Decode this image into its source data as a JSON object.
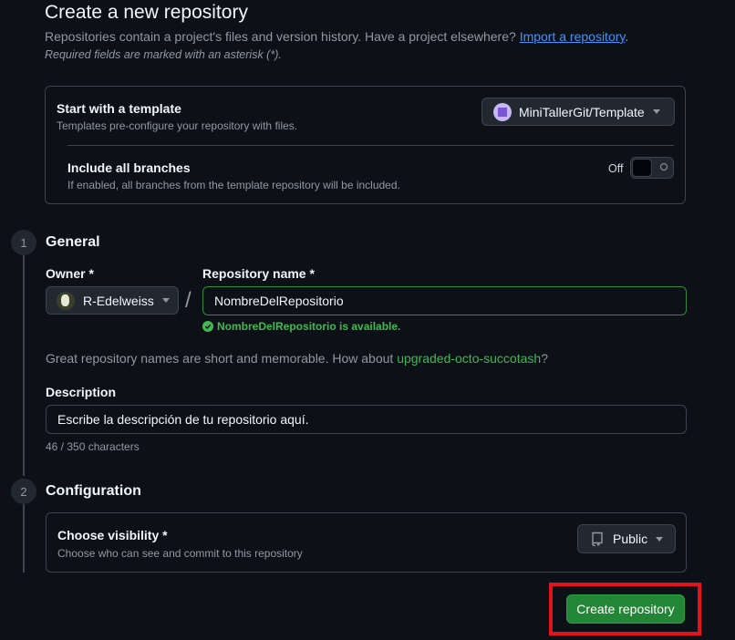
{
  "header": {
    "title": "Create a new repository",
    "subtitle": "Repositories contain a project's files and version history. Have a project elsewhere?",
    "import_link": "Import a repository",
    "subtitle_end": ".",
    "required_note": "Required fields are marked with an asterisk (*)."
  },
  "template": {
    "title": "Start with a template",
    "description": "Templates pre-configure your repository with files.",
    "selected": "MiniTallerGit/Template",
    "include_branches": {
      "title": "Include all branches",
      "description": "If enabled, all branches from the template repository will be included.",
      "state_label": "Off"
    }
  },
  "general": {
    "step": "1",
    "title": "General",
    "owner_label": "Owner *",
    "owner_value": "R-Edelweiss",
    "separator": "/",
    "name_label": "Repository name *",
    "name_value": "NombreDelRepositorio",
    "availability": "NombreDelRepositorio is available.",
    "hint_prefix": "Great repository names are short and memorable. How about",
    "hint_suggestion": "upgraded-octo-succotash",
    "hint_suffix": "?",
    "description_label": "Description",
    "description_value": "Escribe la descripción de tu repositorio aquí.",
    "char_count": "46 / 350 characters"
  },
  "configuration": {
    "step": "2",
    "title": "Configuration",
    "visibility_title": "Choose visibility *",
    "visibility_description": "Choose who can see and commit to this repository",
    "visibility_value": "Public"
  },
  "actions": {
    "create_label": "Create repository"
  },
  "colors": {
    "background": "#0d1117",
    "accent_green": "#238636",
    "success_text": "#3fb950",
    "link_blue": "#4493f8",
    "highlight_red": "#e5121b"
  }
}
